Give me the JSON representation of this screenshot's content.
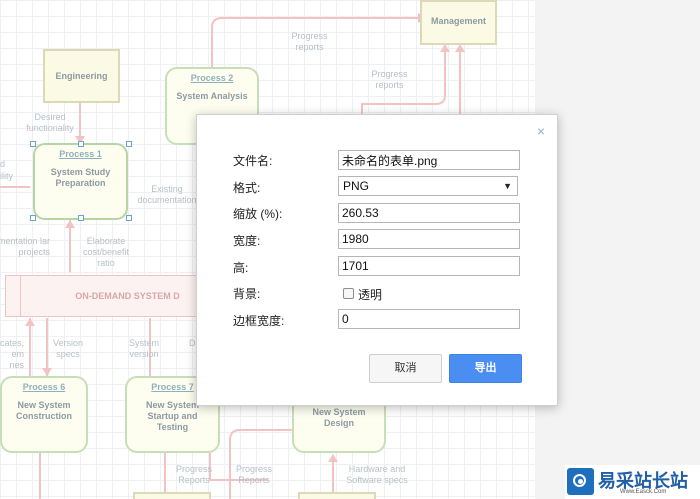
{
  "diagram": {
    "external": {
      "management": "Management",
      "engineering": "Engineering"
    },
    "processes": [
      {
        "id": "p1",
        "title": "Process 1",
        "name": "System Study Preparation"
      },
      {
        "id": "p2",
        "title": "Process 2",
        "name": "System Analysis"
      },
      {
        "id": "p6",
        "title": "Process 6",
        "name": "New System Construction"
      },
      {
        "id": "p7",
        "title": "Process 7",
        "name": "New System Startup and Testing"
      },
      {
        "id": "p8",
        "title": "",
        "name": "New System Design"
      }
    ],
    "datastore": "ON-DEMAND SYSTEM D",
    "labels": {
      "progress_reports_1": "Progress reports",
      "progress_reports_2": "Progress reports",
      "desired_functionality": "Desired functionality",
      "existing_documentation": "Existing documentation",
      "elaborate": "Elaborate cost/benefit ratio",
      "documentation_similar": "mentation lar projects",
      "cates_em_nes": "cates, em nes",
      "version_specs": "Version specs",
      "system_version": "System version",
      "d_partial": "D",
      "progress_reports_3": "Progress Reports",
      "progress_reports_4": "Progress Reports",
      "hardware_specs": "Hardware and Software specs",
      "left_d": "d",
      "left_ility": "ility"
    }
  },
  "dialog": {
    "close_glyph": "×",
    "fields": {
      "filename_label": "文件名:",
      "filename_value": "未命名的表单.png",
      "format_label": "格式:",
      "format_value": "PNG",
      "zoom_label": "缩放 (%):",
      "zoom_value": "260.53",
      "width_label": "宽度:",
      "width_value": "1980",
      "height_label": "高:",
      "height_value": "1701",
      "background_label": "背景:",
      "transparent_label": "透明",
      "transparent_checked": false,
      "border_label": "边框宽度:",
      "border_value": "0"
    },
    "buttons": {
      "cancel": "取消",
      "export": "导出"
    }
  },
  "watermark": {
    "title": "易采站长站",
    "subtitle": "Www.Easck.Com"
  }
}
